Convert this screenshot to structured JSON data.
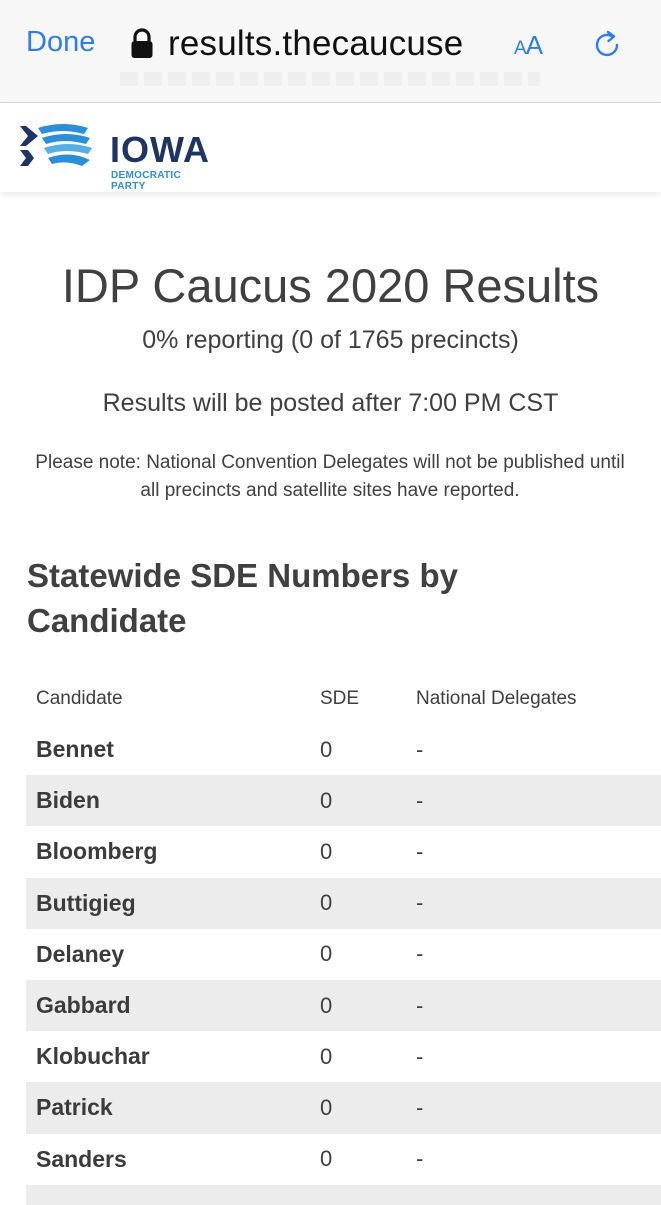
{
  "browser": {
    "done_label": "Done",
    "url": "results.thecaucuse",
    "text_size_label_small": "A",
    "text_size_label_large": "A"
  },
  "site": {
    "logo_word": "IOWA",
    "logo_sub": "DEMOCRATIC PARTY",
    "brand_colors": {
      "navy": "#1e3462",
      "blue": "#2a8fd6"
    }
  },
  "main": {
    "title": "IDP Caucus 2020 Results",
    "reporting": "0% reporting (0 of 1765 precincts)",
    "posted": "Results will be posted after 7:00 PM CST",
    "note": "Please note: National Convention Delegates will not be published until all precincts and satellite sites have reported.",
    "section_title": "Statewide SDE Numbers by Candidate"
  },
  "table": {
    "headers": [
      "Candidate",
      "SDE",
      "National Delegates"
    ],
    "rows": [
      {
        "candidate": "Bennet",
        "sde": "0",
        "delegates": "-"
      },
      {
        "candidate": "Biden",
        "sde": "0",
        "delegates": "-"
      },
      {
        "candidate": "Bloomberg",
        "sde": "0",
        "delegates": "-"
      },
      {
        "candidate": "Buttigieg",
        "sde": "0",
        "delegates": "-"
      },
      {
        "candidate": "Delaney",
        "sde": "0",
        "delegates": "-"
      },
      {
        "candidate": "Gabbard",
        "sde": "0",
        "delegates": "-"
      },
      {
        "candidate": "Klobuchar",
        "sde": "0",
        "delegates": "-"
      },
      {
        "candidate": "Patrick",
        "sde": "0",
        "delegates": "-"
      },
      {
        "candidate": "Sanders",
        "sde": "0",
        "delegates": "-"
      }
    ]
  },
  "icons": {
    "lock": "lock-icon",
    "reload": "reload-icon",
    "logo": "iowa-map-logo"
  },
  "colors": {
    "link_blue": "#2f7bf5",
    "row_alt": "#ececec"
  }
}
